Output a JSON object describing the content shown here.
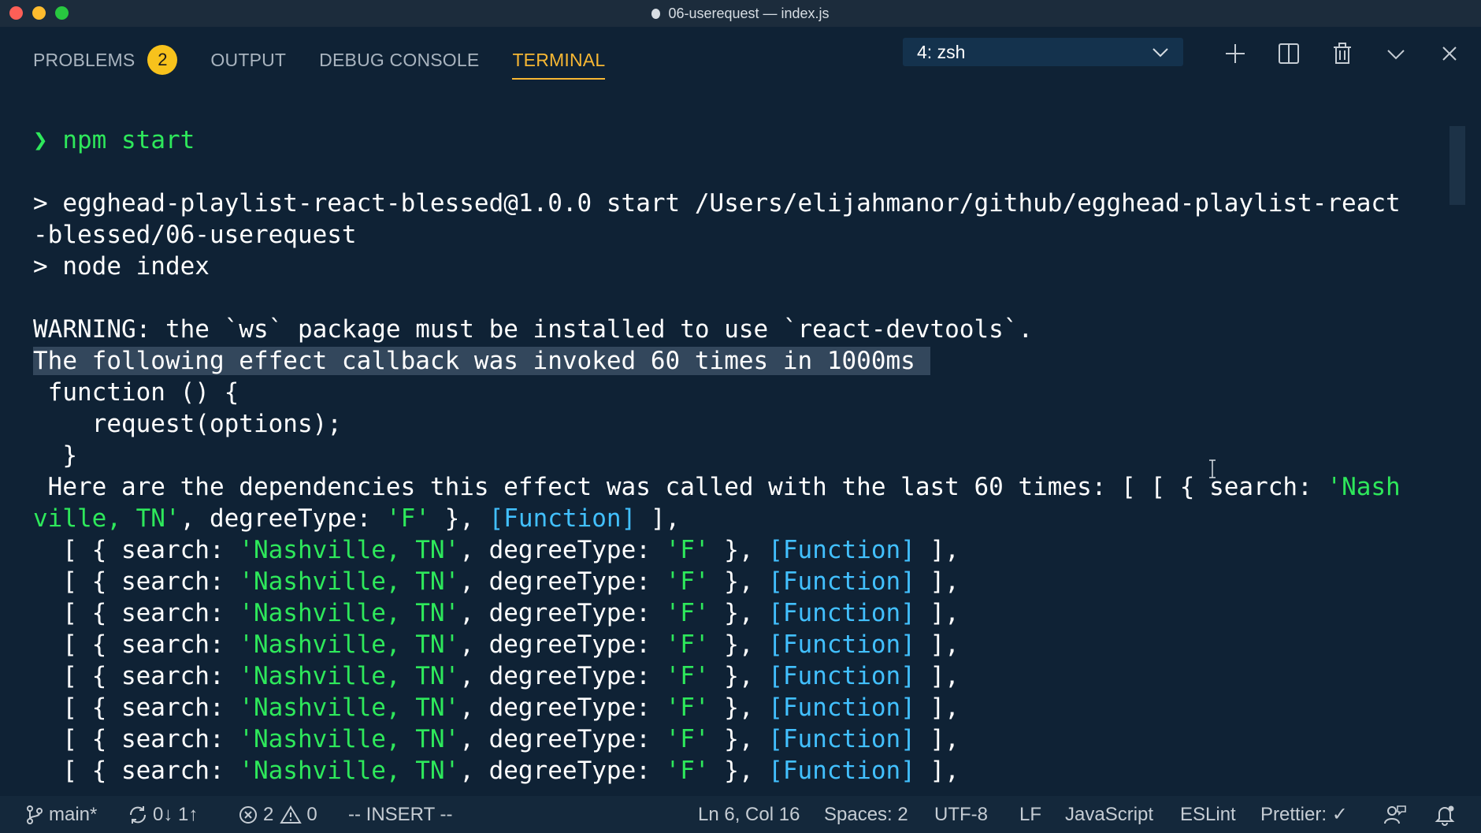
{
  "window": {
    "title": "06-userequest — index.js"
  },
  "panel": {
    "tabs": [
      {
        "label": "PROBLEMS",
        "badge": "2"
      },
      {
        "label": "OUTPUT"
      },
      {
        "label": "DEBUG CONSOLE"
      },
      {
        "label": "TERMINAL",
        "active": true
      }
    ],
    "terminal_select": "4: zsh",
    "actions": [
      "plus-icon",
      "split-icon",
      "trash-icon",
      "chevron-down-icon",
      "close-icon"
    ]
  },
  "terminal": {
    "prompt_symbol": "❯",
    "command": "npm start",
    "script_line_1": "> egghead-playlist-react-blessed@1.0.0 start /Users/elijahmanor/github/egghead-playlist-react",
    "script_line_2": "-blessed/06-userequest",
    "script_line_3": "> node index",
    "warning": "WARNING: the `ws` package must be installed to use `react-devtools`.",
    "highlighted": "The following effect callback was invoked 60 times in 1000ms",
    "fn_line_1": " function () {",
    "fn_line_2": "    request(options);",
    "fn_line_3": "  }",
    "deps_prefix": " Here are the dependencies this effect was called with the last 60 times: [ [ { search: ",
    "deps_str_start": "'Nash",
    "wrap_str_end": "ville, TN'",
    "wrap_mid": ", degreeType: ",
    "wrap_f": "'F'",
    "wrap_close": " }, ",
    "wrap_fn": "[Function]",
    "wrap_end": " ],",
    "row": {
      "open": "  [ { search: ",
      "city": "'Nashville, TN'",
      "mid": ", degreeType: ",
      "deg": "'F'",
      "close": " }, ",
      "fn": "[Function]",
      "end": " ],"
    },
    "repeat_rows": 8
  },
  "statusbar": {
    "branch": "main*",
    "sync": "0↓ 1↑",
    "errors": "2",
    "warnings": "0",
    "mode": "-- INSERT --",
    "position": "Ln 6, Col 16",
    "spaces": "Spaces: 2",
    "encoding": "UTF-8",
    "eol": "LF",
    "language": "JavaScript",
    "linter": "ESLint",
    "formatter": "Prettier: ✓"
  },
  "colors": {
    "accent": "#f7b733",
    "string": "#2ee85b",
    "function": "#42c0ff",
    "background": "#0f2235"
  }
}
